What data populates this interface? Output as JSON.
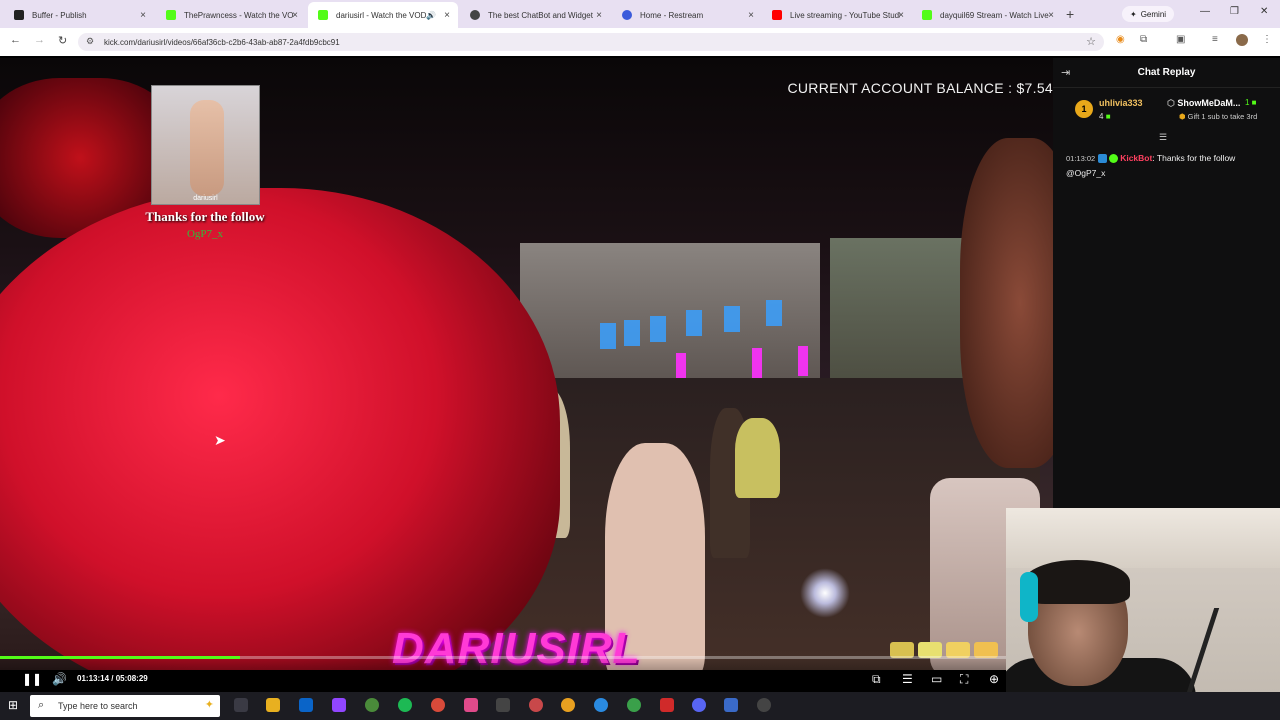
{
  "browser": {
    "tabs": [
      {
        "title": "Buffer - Publish",
        "favicon_color": "#222222",
        "active": false
      },
      {
        "title": "ThePrawncess - Watch the VOD",
        "favicon_color": "#53fc18",
        "active": false
      },
      {
        "title": "dariusirl - Watch the VOD",
        "favicon_color": "#53fc18",
        "active": true
      },
      {
        "title": "The best ChatBot and Widget",
        "favicon_color": "#444444",
        "active": false
      },
      {
        "title": "Home - Restream",
        "favicon_color": "#3b5bdb",
        "active": false
      },
      {
        "title": "Live streaming - YouTube Studio",
        "favicon_color": "#ff0000",
        "active": false
      },
      {
        "title": "dayquil69 Stream - Watch Live",
        "favicon_color": "#53fc18",
        "active": false
      }
    ],
    "close_glyph": "×",
    "new_tab_glyph": "+",
    "gemini_label": "Gemini",
    "url": "kick.com/dariusirl/videos/66af36cb-c2b6-43ab-ab87-2a4fdb9cbc91"
  },
  "video": {
    "balance_text": "CURRENT ACCOUNT BALANCE : $7.54",
    "alert_image_caption": "dariusirl",
    "alert_text": "Thanks for the follow",
    "alert_user": "OgP7_x",
    "logo_text": "DARIUSIRL",
    "current_time": "01:13:14",
    "total_time": "05:08:29",
    "progress_fraction": 0.238
  },
  "chat": {
    "title": "Chat Replay",
    "pinned": {
      "rank": "1",
      "user1": "uhlivia333",
      "count1": "4",
      "user2": "ShowMeDaM...",
      "count2": "1",
      "note": "Gift 1 sub to take 3rd"
    },
    "message": {
      "time": "01:13:02",
      "user": "KickBot",
      "text": ": Thanks for the follow @OgP7_x"
    }
  },
  "taskbar": {
    "search_placeholder": "Type here to search"
  },
  "colors": {
    "kick_green": "#53fc18",
    "tabbar_bg": "#e8e0f2",
    "chat_bg": "#0f0f10"
  }
}
